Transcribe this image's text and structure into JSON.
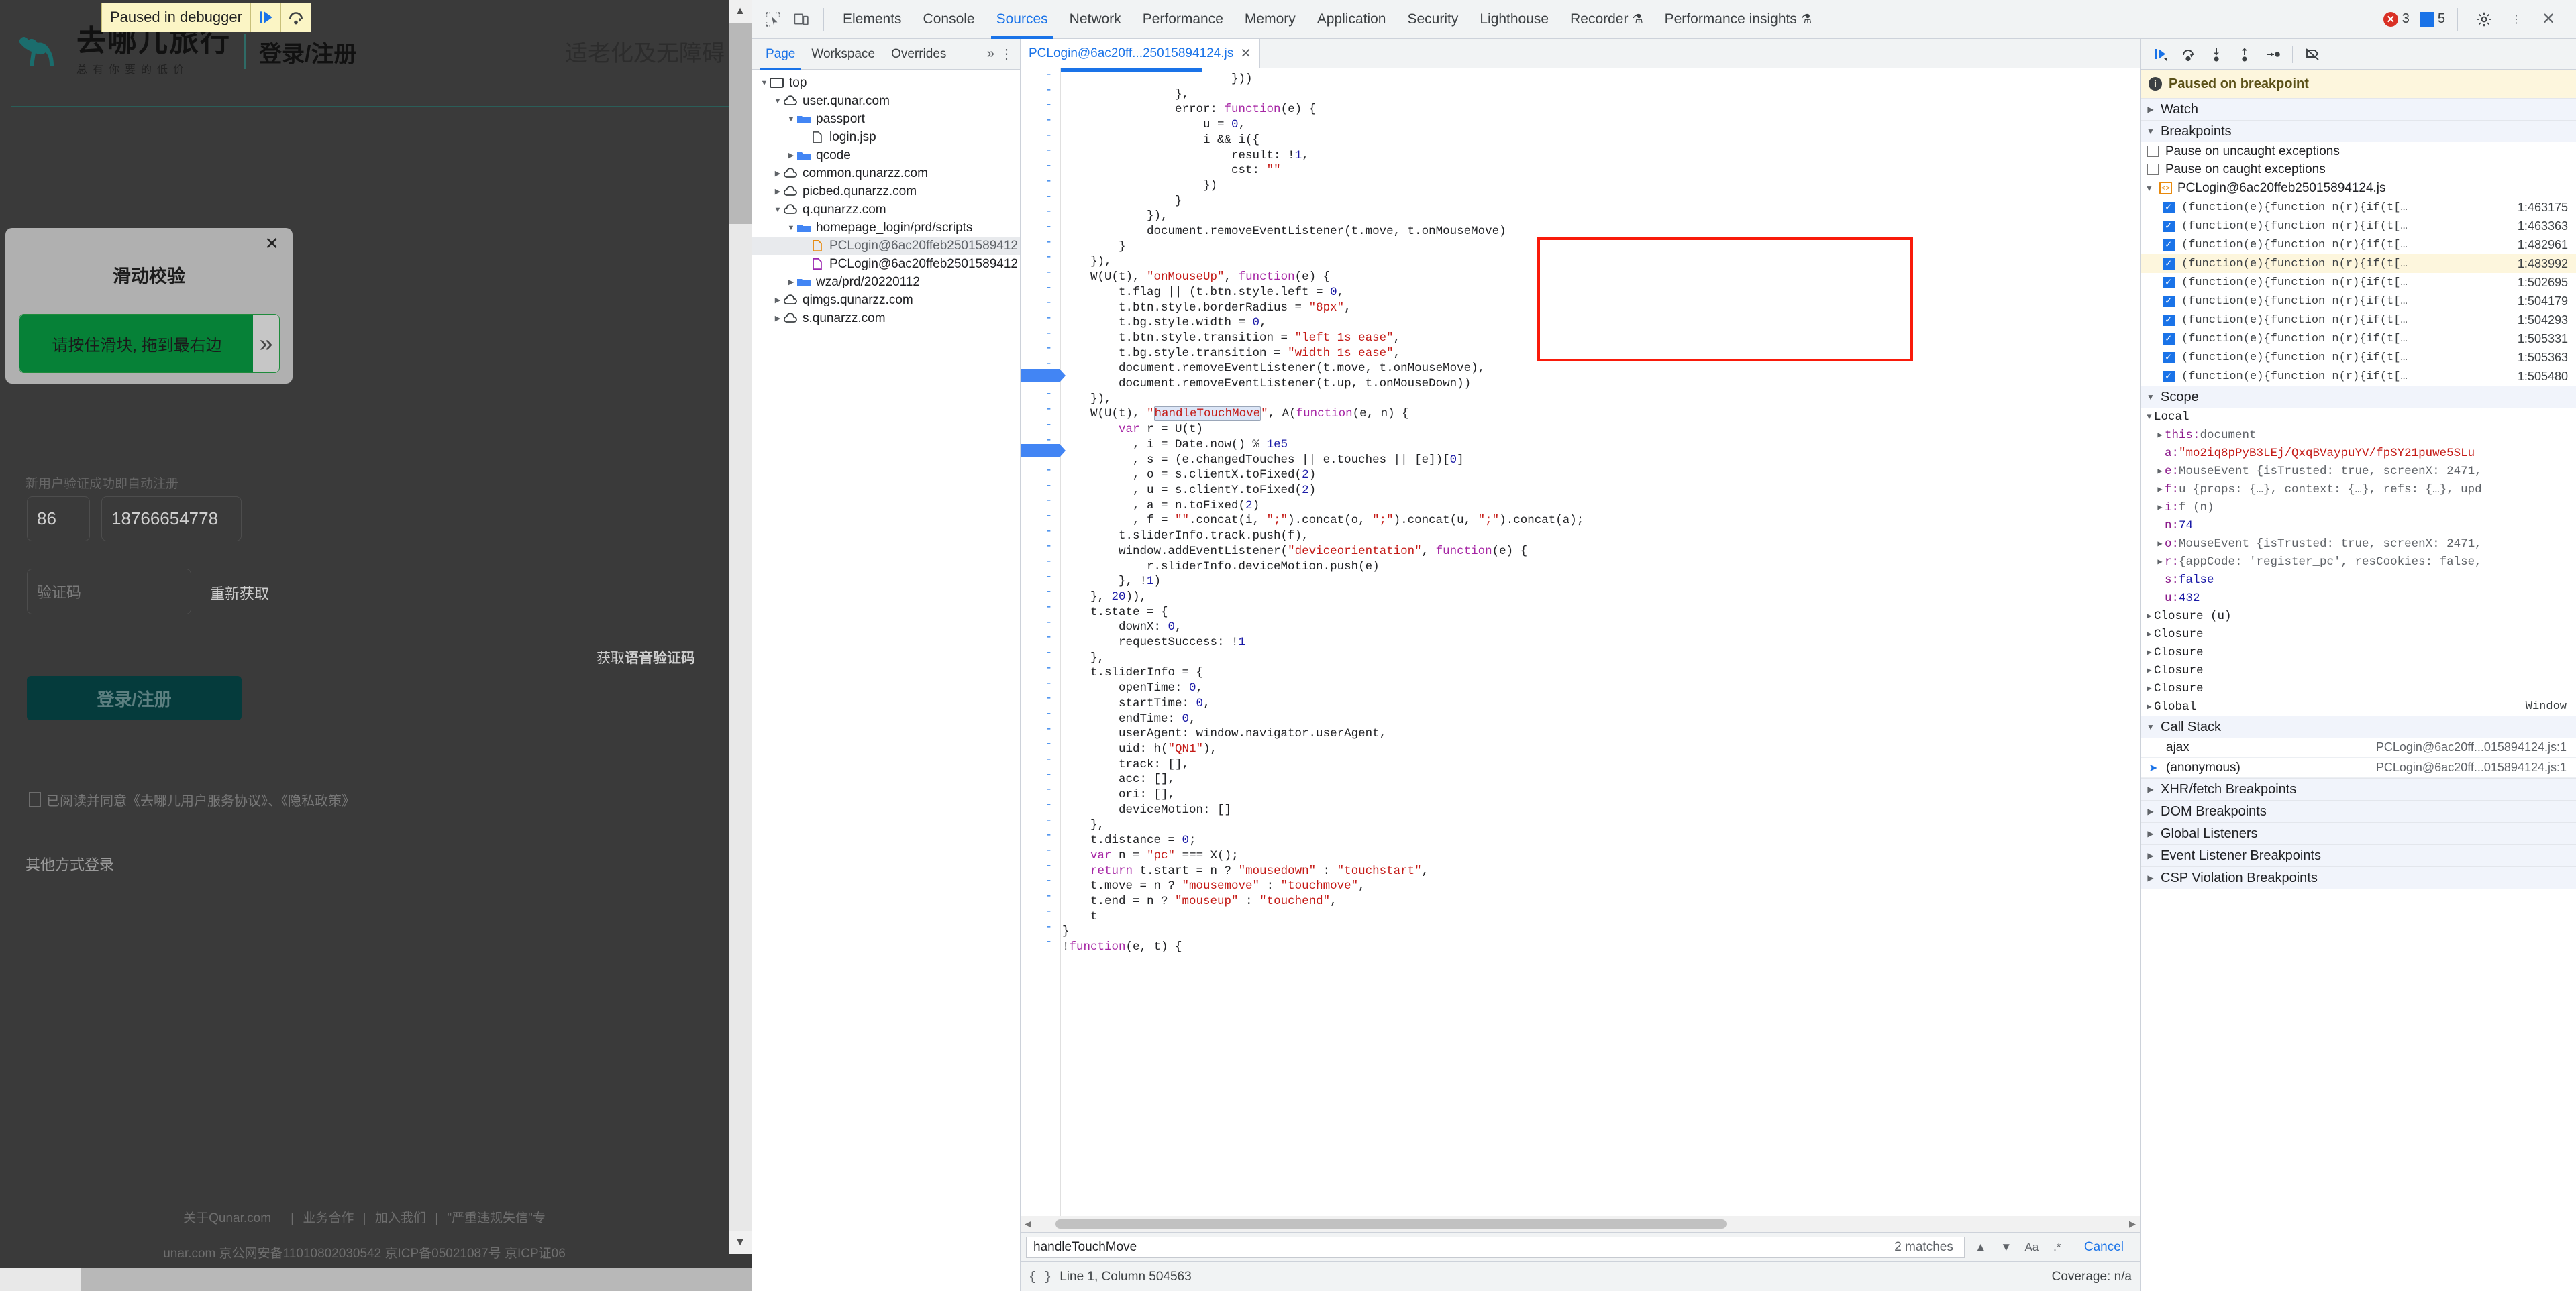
{
  "webpage": {
    "pause_badge": {
      "label": "Paused in debugger",
      "resume_icon": "resume-icon",
      "step_icon": "step-over-icon"
    },
    "header": {
      "logo_main": "去哪儿旅行",
      "logo_sub": "总有你要的低价",
      "login_title": "登录/注册",
      "accessibility": "适老化及无障碍"
    },
    "captcha": {
      "title": "滑动校验",
      "close": "✕",
      "slider_text": "请按住滑块, 拖到最右边",
      "knob_icon": "chevron-double-right-icon"
    },
    "form": {
      "auto_register_note": "新用户验证成功即自动注册",
      "country_code": "86",
      "phone": "18766654778",
      "captcha_placeholder": "验证码",
      "resend_label": "重新获取",
      "voice_prefix": "获取",
      "voice_strong": "语音验证码",
      "submit_label": "登录/注册",
      "agree_text": "已阅读并同意《去哪儿用户服务协议》、《隐私政策》",
      "other_login": "其他方式登录"
    },
    "footer": {
      "links": [
        "关于Qunar.com",
        "业务合作",
        "加入我们",
        "\"严重违规失信\"专"
      ],
      "icp": "unar.com  京公网安备11010802030542  京ICP备05021087号  京ICP证06"
    }
  },
  "devtools": {
    "topbar": {
      "inspect_icon": "inspect-element-icon",
      "device_icon": "device-toolbar-icon",
      "tabs": [
        {
          "label": "Elements",
          "active": false
        },
        {
          "label": "Console",
          "active": false
        },
        {
          "label": "Sources",
          "active": true
        },
        {
          "label": "Network",
          "active": false
        },
        {
          "label": "Performance",
          "active": false
        },
        {
          "label": "Memory",
          "active": false
        },
        {
          "label": "Application",
          "active": false
        },
        {
          "label": "Security",
          "active": false
        },
        {
          "label": "Lighthouse",
          "active": false
        },
        {
          "label": "Recorder",
          "active": false,
          "beaker": true
        },
        {
          "label": "Performance insights",
          "active": false,
          "beaker": true
        }
      ],
      "error_count": "3",
      "info_count": "5",
      "settings_icon": "gear-icon",
      "more_icon": "kebab-menu-icon",
      "close_icon": "close-icon"
    },
    "navigator": {
      "tabs": [
        {
          "label": "Page",
          "active": true
        },
        {
          "label": "Workspace",
          "active": false
        },
        {
          "label": "Overrides",
          "active": false
        }
      ],
      "overflow_icon": "chevron-double-right-icon",
      "more_icon": "kebab-menu-icon",
      "tree": [
        {
          "label": "top",
          "depth": 0,
          "icon": "frame-icon",
          "twisty": "down",
          "selected": false
        },
        {
          "label": "user.qunar.com",
          "depth": 1,
          "icon": "cloud-icon",
          "twisty": "down",
          "selected": false
        },
        {
          "label": "passport",
          "depth": 2,
          "icon": "folder-icon",
          "twisty": "down",
          "selected": false
        },
        {
          "label": "login.jsp",
          "depth": 3,
          "icon": "document-icon",
          "twisty": "none",
          "selected": false
        },
        {
          "label": "qcode",
          "depth": 2,
          "icon": "folder-icon",
          "twisty": "right",
          "selected": false
        },
        {
          "label": "common.qunarzz.com",
          "depth": 1,
          "icon": "cloud-icon",
          "twisty": "right",
          "selected": false
        },
        {
          "label": "picbed.qunarzz.com",
          "depth": 1,
          "icon": "cloud-icon",
          "twisty": "right",
          "selected": false
        },
        {
          "label": "q.qunarzz.com",
          "depth": 1,
          "icon": "cloud-icon",
          "twisty": "down",
          "selected": false
        },
        {
          "label": "homepage_login/prd/scripts",
          "depth": 2,
          "icon": "folder-icon",
          "twisty": "down",
          "selected": false
        },
        {
          "label": "PCLogin@6ac20ffeb2501589412",
          "depth": 3,
          "icon": "js-file-icon",
          "twisty": "none",
          "selected": true
        },
        {
          "label": "PCLogin@6ac20ffeb2501589412",
          "depth": 3,
          "icon": "css-file-icon",
          "twisty": "none",
          "selected": false
        },
        {
          "label": "wza/prd/20220112",
          "depth": 2,
          "icon": "folder-icon",
          "twisty": "right",
          "selected": false
        },
        {
          "label": "qimgs.qunarzz.com",
          "depth": 1,
          "icon": "cloud-icon",
          "twisty": "right",
          "selected": false
        },
        {
          "label": "s.qunarzz.com",
          "depth": 1,
          "icon": "cloud-icon",
          "twisty": "right",
          "selected": false
        }
      ]
    },
    "editor": {
      "tab_label": "PCLogin@6ac20ff...25015894124.js",
      "tab_close": "✕",
      "highlight_token": "handleTouchMove",
      "code_lines": [
        "                        }))",
        "                },",
        "                error: function(e) {",
        "                    u = 0,",
        "                    i && i({",
        "                        result: !1,",
        "                        cst: \"\"",
        "                    })",
        "                }",
        "            }),",
        "            document.removeEventListener(t.move, t.onMouseMove)",
        "        }",
        "    }),",
        "    W(U(t), \"onMouseUp\", function(e) {",
        "        t.flag || (t.btn.style.left = 0,",
        "        t.btn.style.borderRadius = \"8px\",",
        "        t.bg.style.width = 0,",
        "        t.btn.style.transition = \"left 1s ease\",",
        "        t.bg.style.transition = \"width 1s ease\",",
        "        document.removeEventListener(t.move, t.onMouseMove),",
        "        document.removeEventListener(t.up, t.onMouseDown))",
        "    }),",
        "    W(U(t), \"handleTouchMove\", A(function(e, n) {",
        "        var r = U(t)",
        "          , i = Date.now() % 1e5",
        "          , s = (e.changedTouches || e.touches || [e])[0]",
        "          , o = s.clientX.toFixed(2)",
        "          , u = s.clientY.toFixed(2)",
        "          , a = n.toFixed(2)",
        "          , f = \"\".concat(i, \";\").concat(o, \";\").concat(u, \";\").concat(a);",
        "        t.sliderInfo.track.push(f),",
        "        window.addEventListener(\"deviceorientation\", function(e) {",
        "            r.sliderInfo.deviceMotion.push(e)",
        "        }, !1)",
        "    }, 20)),",
        "    t.state = {",
        "        downX: 0,",
        "        requestSuccess: !1",
        "    },",
        "    t.sliderInfo = {",
        "        openTime: 0,",
        "        startTime: 0,",
        "        endTime: 0,",
        "        userAgent: window.navigator.userAgent,",
        "        uid: h(\"QN1\"),",
        "        track: [],",
        "        acc: [],",
        "        ori: [],",
        "        deviceMotion: []",
        "    },",
        "    t.distance = 0;",
        "    var n = \"pc\" === X();",
        "    return t.start = n ? \"mousedown\" : \"touchstart\",",
        "    t.move = n ? \"mousemove\" : \"touchmove\",",
        "    t.end = n ? \"mouseup\" : \"touchend\",",
        "    t",
        "}",
        "!function(e, t) {"
      ]
    },
    "find": {
      "query": "handleTouchMove",
      "matches": "2 matches",
      "prev_icon": "chevron-up-icon",
      "next_icon": "chevron-down-icon",
      "match_case": "Aa",
      "regex": ".*",
      "cancel_label": "Cancel"
    },
    "status": {
      "format_icon": "pretty-print-icon",
      "position": "Line 1, Column 504563",
      "coverage": "Coverage: n/a"
    },
    "debugger": {
      "toolbar": [
        {
          "icon": "resume-script-icon",
          "name": "resume-button"
        },
        {
          "icon": "step-over-icon",
          "name": "step-over-button"
        },
        {
          "icon": "step-into-icon",
          "name": "step-into-button"
        },
        {
          "icon": "step-out-icon",
          "name": "step-out-button"
        },
        {
          "icon": "step-icon",
          "name": "step-button"
        },
        {
          "icon": "deactivate-breakpoints-icon",
          "name": "deactivate-breakpoints-button"
        }
      ],
      "paused_message": "Paused on breakpoint",
      "watch_label": "Watch",
      "breakpoints_label": "Breakpoints",
      "pause_uncaught_label": "Pause on uncaught exceptions",
      "pause_caught_label": "Pause on caught exceptions",
      "breakpoint_file": "PCLogin@6ac20ffeb25015894124.js",
      "breakpoint_items": [
        {
          "snippet": "(function(e){function n(r){if(t[…",
          "location": "1:463175",
          "checked": true,
          "current": false
        },
        {
          "snippet": "(function(e){function n(r){if(t[…",
          "location": "1:463363",
          "checked": true,
          "current": false
        },
        {
          "snippet": "(function(e){function n(r){if(t[…",
          "location": "1:482961",
          "checked": true,
          "current": false
        },
        {
          "snippet": "(function(e){function n(r){if(t[…",
          "location": "1:483992",
          "checked": true,
          "current": true
        },
        {
          "snippet": "(function(e){function n(r){if(t[…",
          "location": "1:502695",
          "checked": true,
          "current": false
        },
        {
          "snippet": "(function(e){function n(r){if(t[…",
          "location": "1:504179",
          "checked": true,
          "current": false
        },
        {
          "snippet": "(function(e){function n(r){if(t[…",
          "location": "1:504293",
          "checked": true,
          "current": false
        },
        {
          "snippet": "(function(e){function n(r){if(t[…",
          "location": "1:505331",
          "checked": true,
          "current": false
        },
        {
          "snippet": "(function(e){function n(r){if(t[…",
          "location": "1:505363",
          "checked": true,
          "current": false
        },
        {
          "snippet": "(function(e){function n(r){if(t[…",
          "location": "1:505480",
          "checked": true,
          "current": false
        }
      ],
      "scope_label": "Scope",
      "local_label": "Local",
      "scope_items": [
        {
          "name": "this",
          "value": "document",
          "expandable": true
        },
        {
          "name": "a",
          "value": "\"mo2iq8pPyB3LEj/QxqBVaypuYV/fpSY21puwe5SLu",
          "expandable": false,
          "kind": "string"
        },
        {
          "name": "e",
          "value": "MouseEvent {isTrusted: true, screenX: 2471,",
          "expandable": true
        },
        {
          "name": "f",
          "value": "u {props: {…}, context: {…}, refs: {…}, upd",
          "expandable": true
        },
        {
          "name": "i",
          "value": "f (n)",
          "expandable": true
        },
        {
          "name": "n",
          "value": "74",
          "expandable": false,
          "kind": "number"
        },
        {
          "name": "o",
          "value": "MouseEvent {isTrusted: true, screenX: 2471,",
          "expandable": true
        },
        {
          "name": "r",
          "value": "{appCode: 'register_pc', resCookies: false,",
          "expandable": true
        },
        {
          "name": "s",
          "value": "false",
          "expandable": false,
          "kind": "number"
        },
        {
          "name": "u",
          "value": "432",
          "expandable": false,
          "kind": "number"
        }
      ],
      "closures": [
        "Closure (u)",
        "Closure",
        "Closure",
        "Closure",
        "Closure"
      ],
      "global_label": "Global",
      "global_value": "Window",
      "call_stack_label": "Call Stack",
      "call_stack": [
        {
          "fn": "ajax",
          "url": "PCLogin@6ac20ff...015894124.js:1",
          "active": false
        },
        {
          "fn": "(anonymous)",
          "url": "PCLogin@6ac20ff...015894124.js:1",
          "active": true
        }
      ],
      "sections": [
        "XHR/fetch Breakpoints",
        "DOM Breakpoints",
        "Global Listeners",
        "Event Listener Breakpoints",
        "CSP Violation Breakpoints"
      ]
    }
  }
}
